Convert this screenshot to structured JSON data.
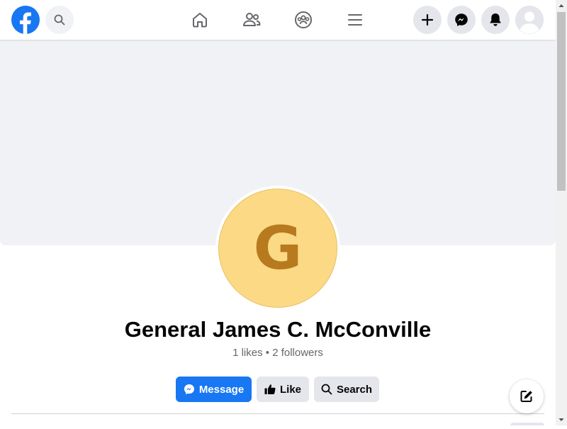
{
  "colors": {
    "brand_blue": "#1877f2",
    "cover_bg": "#f0f2f5",
    "avatar_bg": "#fcd985",
    "avatar_letter": "#b87a1e"
  },
  "topbar": {
    "logo_icon": "facebook-logo-icon",
    "search_icon": "search-icon",
    "nav_icons": [
      "home-icon",
      "friends-icon",
      "groups-icon",
      "menu-icon"
    ],
    "right_icons": [
      "plus-icon",
      "messenger-icon",
      "bell-icon",
      "account-avatar-icon"
    ]
  },
  "profile": {
    "initial": "G",
    "name": "General James C. McConville",
    "stats": "1 likes • 2 followers"
  },
  "actions": {
    "message_label": "Message",
    "like_label": "Like",
    "search_label": "Search"
  }
}
